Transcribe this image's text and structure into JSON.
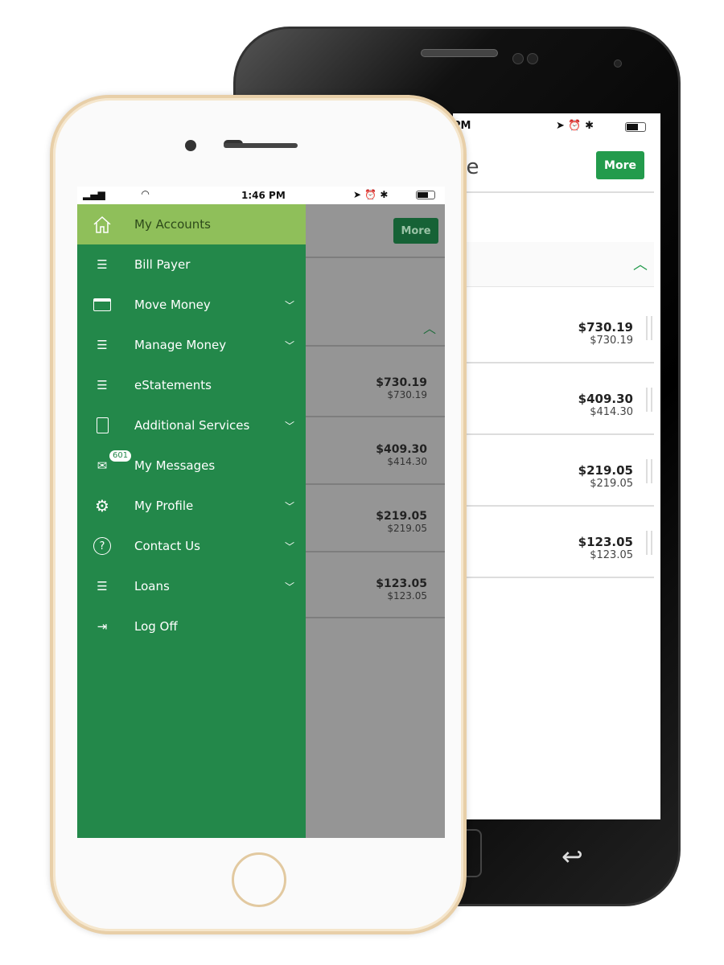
{
  "back_phone": {
    "status_time": "PM",
    "title_fragment": "ne",
    "more_label": "More",
    "accounts": [
      {
        "balance": "$730.19",
        "available": "$730.19"
      },
      {
        "balance": "$409.30",
        "available": "$414.30"
      },
      {
        "balance": "$219.05",
        "available": "$219.05"
      },
      {
        "balance": "$123.05",
        "available": "$123.05"
      }
    ]
  },
  "front_phone": {
    "status_time": "1:46 PM",
    "more_label": "More",
    "menu": [
      {
        "label": "My Accounts",
        "icon": "home-icon",
        "active": true
      },
      {
        "label": "Bill Payer",
        "icon": "menu-icon"
      },
      {
        "label": "Move Money",
        "icon": "card-icon",
        "expandable": true
      },
      {
        "label": "Manage Money",
        "icon": "menu-icon",
        "expandable": true
      },
      {
        "label": "eStatements",
        "icon": "menu-icon"
      },
      {
        "label": "Additional Services",
        "icon": "calculator-icon",
        "expandable": true
      },
      {
        "label": "My Messages",
        "icon": "mail-icon",
        "badge": "601"
      },
      {
        "label": "My Profile",
        "icon": "gear-icon",
        "expandable": true
      },
      {
        "label": "Contact Us",
        "icon": "help-icon",
        "expandable": true
      },
      {
        "label": "Loans",
        "icon": "menu-icon",
        "expandable": true
      },
      {
        "label": "Log Off",
        "icon": "logout-icon"
      }
    ],
    "accounts": [
      {
        "balance": "$730.19",
        "available": "$730.19"
      },
      {
        "balance": "$409.30",
        "available": "$414.30"
      },
      {
        "balance": "$219.05",
        "available": "$219.05"
      },
      {
        "balance": "$123.05",
        "available": "$123.05"
      }
    ]
  },
  "colors": {
    "drawer": "#23884a",
    "active_item": "#8fbf5a",
    "button": "#239b4c"
  }
}
